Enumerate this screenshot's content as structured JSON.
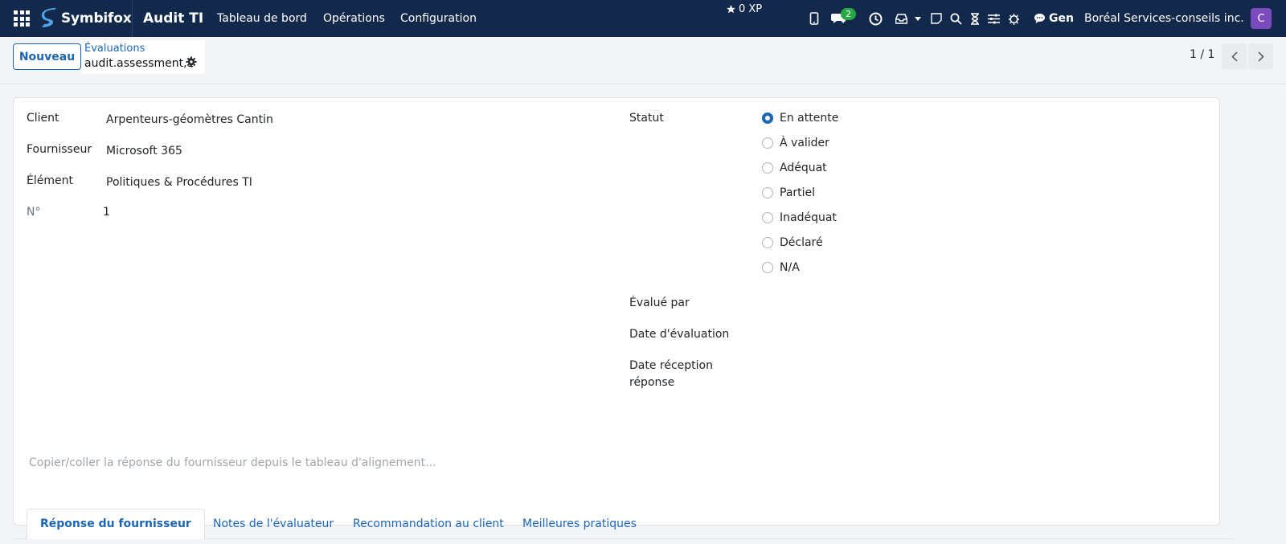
{
  "navbar": {
    "logo_text": "Symbifox",
    "app_title": "Audit TI",
    "menus": [
      "Tableau de bord",
      "Opérations",
      "Configuration"
    ],
    "xp": "0 XP",
    "messages_count": "2",
    "gen_label": "Gen",
    "company": "Boréal Services-conseils inc.",
    "avatar_initial": "C",
    "icons": [
      "mobile-icon",
      "chat-icon",
      "clock-icon",
      "inbox-icon",
      "caret-icon",
      "note-icon",
      "search-icon",
      "hourglass-icon",
      "sliders-icon",
      "bug-icon"
    ]
  },
  "control": {
    "new_button": "Nouveau",
    "breadcrumb_parent": "Évaluations",
    "breadcrumb_current": "audit.assessment,1",
    "pager": "1 / 1"
  },
  "form": {
    "left": [
      {
        "label": "Client",
        "value": "Arpenteurs-géomètres Cantin"
      },
      {
        "label": "Fournisseur",
        "value": "Microsoft 365"
      },
      {
        "label": "Élément",
        "value": "Politiques & Procédures TI"
      },
      {
        "label": "N°",
        "value": "1"
      }
    ],
    "status_label": "Statut",
    "status_options": [
      "En attente",
      "À valider",
      "Adéquat",
      "Partiel",
      "Inadéquat",
      "Déclaré",
      "N/A"
    ],
    "status_selected": "En attente",
    "evaluated_by_label": "Évalué par",
    "evaluation_date_label": "Date d'évaluation",
    "response_date_label_1": "Date réception",
    "response_date_label_2": "réponse"
  },
  "tabs": [
    "Réponse du fournisseur",
    "Notes de l'évaluateur",
    "Recommandation au client",
    "Meilleures pratiques"
  ],
  "notes_placeholder": "Copier/coller la réponse du fournisseur depuis le tableau d'alignement...",
  "colors": {
    "navbar": "#13294b",
    "accent": "#1e66b3",
    "avatar": "#7b4bbd",
    "badge": "#28a745"
  }
}
